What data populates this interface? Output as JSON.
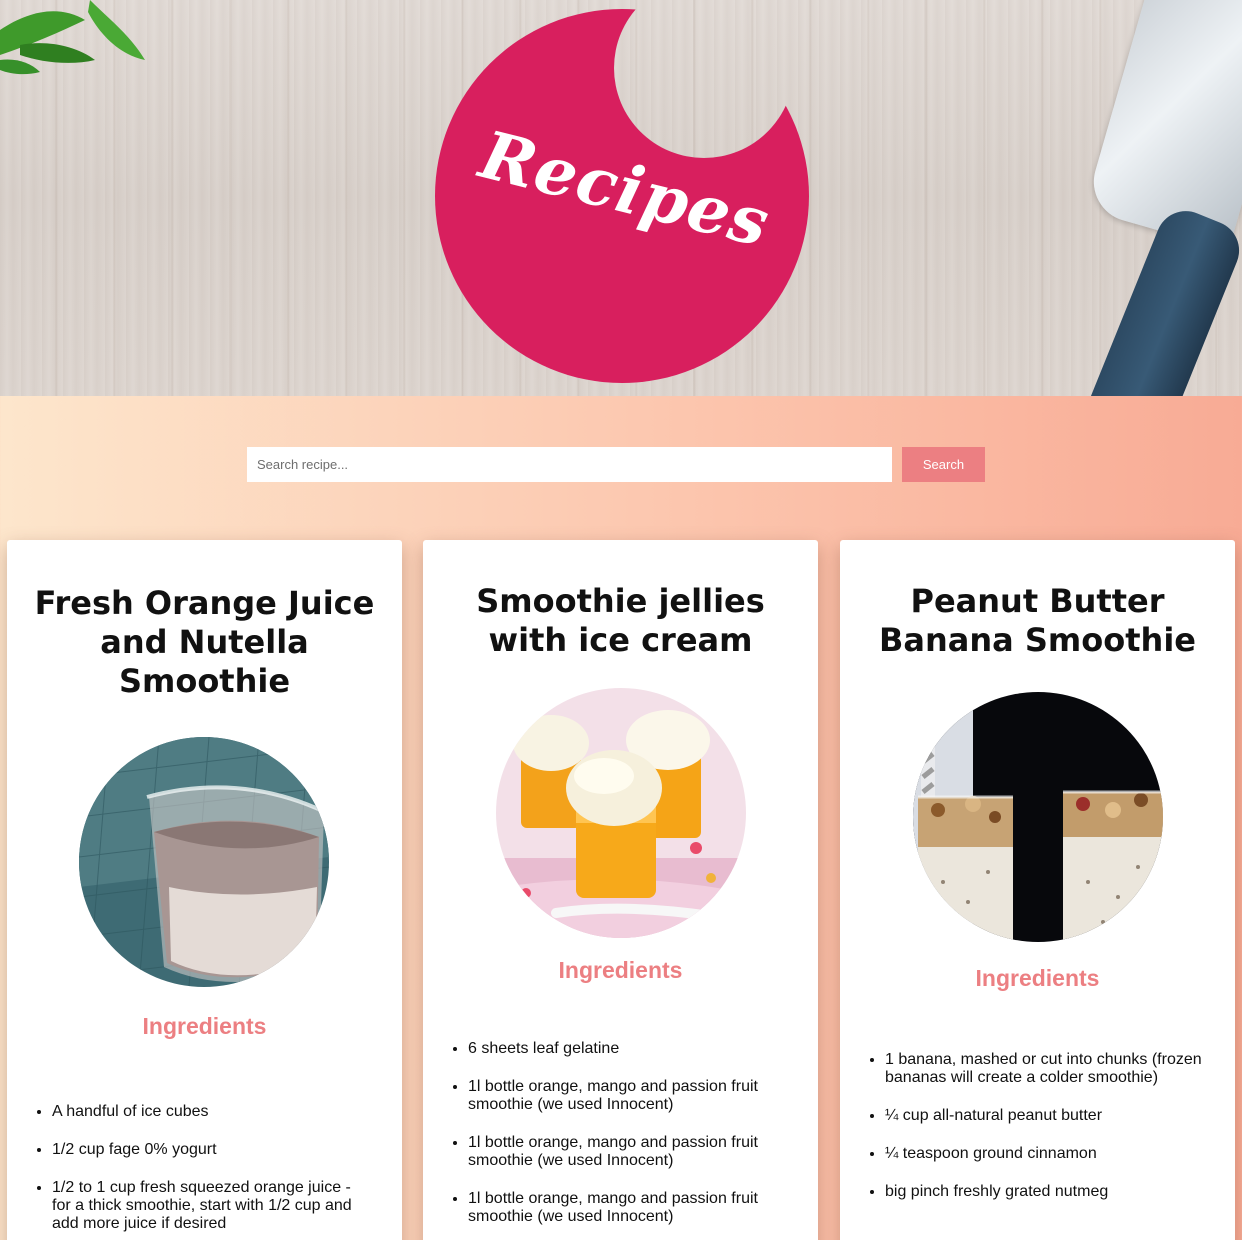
{
  "logo": {
    "text": "Recipes",
    "color": "#d81f5e"
  },
  "search": {
    "placeholder": "Search recipe...",
    "button_label": "Search"
  },
  "recipes": [
    {
      "title": "Fresh Orange Juice and Nutella Smoothie",
      "photo_icon": "smoothie-glass-photo",
      "ingredients_heading": "Ingredients",
      "ingredients": [
        "A handful of ice cubes",
        "1/2 cup fage 0% yogurt",
        "1/2 to 1 cup fresh squeezed orange juice - for a thick smoothie, start with 1/2 cup and add more juice if desired"
      ]
    },
    {
      "title": "Smoothie jellies with ice cream",
      "photo_icon": "jelly-ice-cream-photo",
      "ingredients_heading": "Ingredients",
      "ingredients": [
        "6 sheets leaf gelatine",
        "1l bottle orange, mango and passion fruit smoothie (we used Innocent)",
        "1l bottle orange, mango and passion fruit smoothie (we used Innocent)",
        "1l bottle orange, mango and passion fruit smoothie (we used Innocent)"
      ]
    },
    {
      "title": "Peanut Butter Banana Smoothie",
      "photo_icon": "banana-smoothie-photo",
      "ingredients_heading": "Ingredients",
      "ingredients": [
        "1 banana, mashed or cut into chunks (frozen bananas will create a colder smoothie)",
        "¼ cup all-natural peanut butter",
        "¼ teaspoon ground cinnamon",
        "big pinch freshly grated nutmeg"
      ]
    }
  ],
  "colors": {
    "accent": "#ec7f82",
    "logo": "#d81f5e"
  }
}
